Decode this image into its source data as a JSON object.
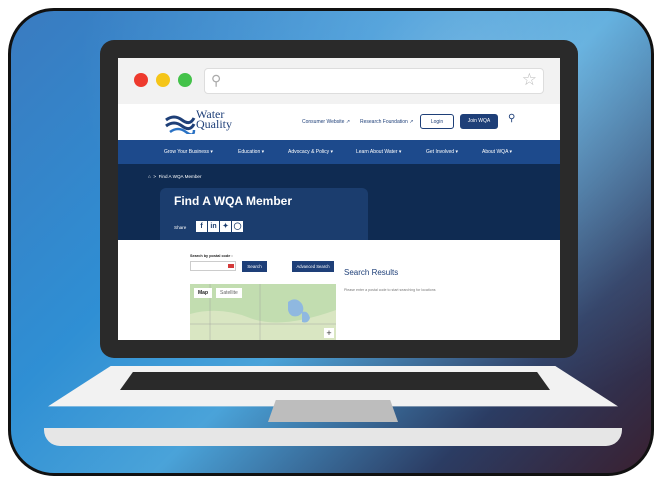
{
  "colors": {
    "brand": "#1e3f78",
    "nav": "#1d4a8c",
    "hero": "#0f2b52"
  },
  "browser": {
    "address_placeholder": ""
  },
  "header": {
    "logo_line1": "Water",
    "logo_line2": "Quality",
    "links": [
      "Consumer Website ↗",
      "Research Foundation ↗"
    ],
    "login_label": "Login",
    "join_label": "Join WQA"
  },
  "nav": {
    "items": [
      "Grow Your Business ▾",
      "Education ▾",
      "Advocacy & Policy ▾",
      "Learn About Water ▾",
      "Get Involved ▾",
      "About WQA ▾"
    ]
  },
  "hero": {
    "breadcrumb_current": "Find A WQA Member",
    "title": "Find A WQA Member",
    "share_label": "Share"
  },
  "search": {
    "label": "Search by postal code :",
    "search_button": "Search",
    "advanced_button": "Advanced Search"
  },
  "map": {
    "tab_map": "Map",
    "tab_satellite": "Satellite",
    "zoom_in": "+"
  },
  "results": {
    "title": "Search Results",
    "hint": "Please enter a postal code to start searching for locations"
  }
}
